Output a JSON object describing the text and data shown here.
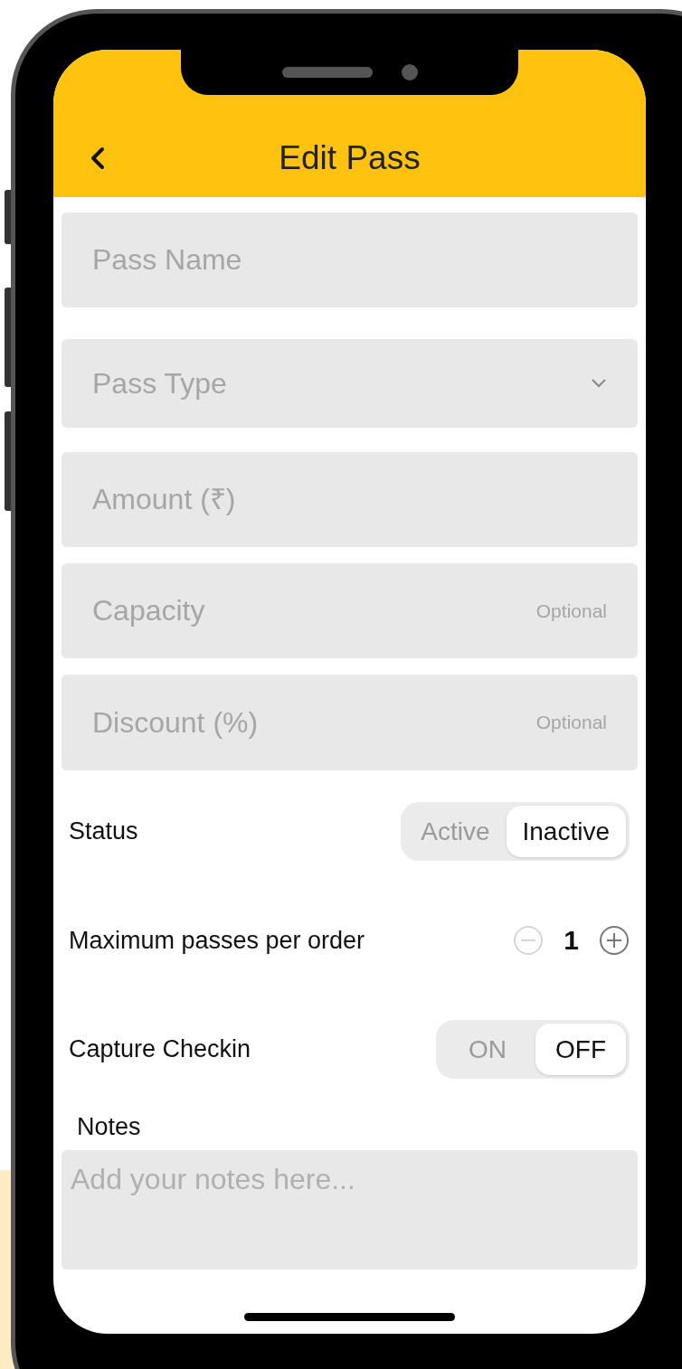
{
  "header": {
    "title": "Edit Pass"
  },
  "fields": [
    {
      "kind": "text",
      "placeholder": "Pass Name"
    },
    {
      "kind": "select",
      "placeholder": "Pass Type"
    },
    {
      "kind": "text",
      "placeholder": "Amount (₹)"
    },
    {
      "kind": "text",
      "placeholder": "Capacity",
      "hint": "Optional"
    },
    {
      "kind": "text",
      "placeholder": "Discount (%)",
      "hint": "Optional"
    }
  ],
  "status": {
    "label": "Status",
    "options": [
      {
        "label": "Active",
        "selected": false
      },
      {
        "label": "Inactive",
        "selected": true
      }
    ]
  },
  "max_passes": {
    "label": "Maximum passes per order",
    "value": "1",
    "decrement_disabled": true
  },
  "capture_checkin": {
    "label": "Capture Checkin",
    "options": [
      {
        "label": "ON",
        "selected": false
      },
      {
        "label": "OFF",
        "selected": true
      }
    ]
  },
  "notes": {
    "label": "Notes",
    "placeholder": "Add your notes here..."
  }
}
